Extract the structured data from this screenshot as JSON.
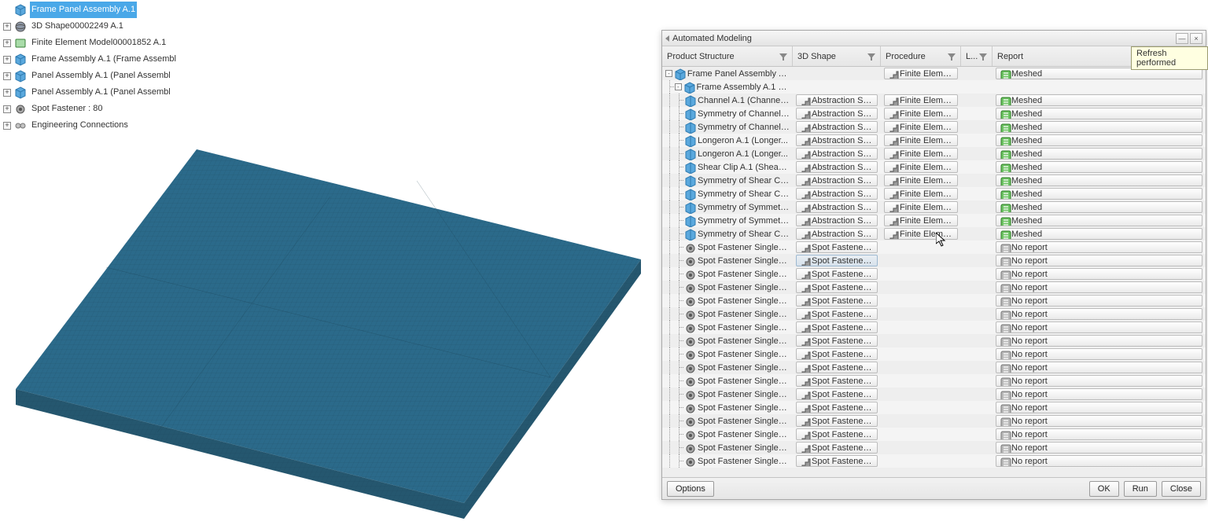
{
  "left_tree": [
    {
      "icon": "cube",
      "label": "Frame Panel Assembly A.1",
      "selected": true,
      "expand": ""
    },
    {
      "icon": "sphere",
      "label": "3D Shape00002249 A.1",
      "expand": "+"
    },
    {
      "icon": "part",
      "label": "Finite Element Model00001852 A.1",
      "expand": "+"
    },
    {
      "icon": "cube",
      "label": "Frame Assembly A.1 (Frame Assembl",
      "expand": "+"
    },
    {
      "icon": "cube",
      "label": "Panel Assembly A.1 (Panel Assembl",
      "expand": "+"
    },
    {
      "icon": "cube",
      "label": "Panel Assembly A.1 (Panel Assembl",
      "expand": "+"
    },
    {
      "icon": "fast",
      "label": "Spot Fastener : 80",
      "expand": "+"
    },
    {
      "icon": "conn",
      "label": "Engineering Connections",
      "expand": "+"
    }
  ],
  "dialog": {
    "title": "Automated Modeling",
    "columns": {
      "ps": "Product Structure",
      "sh": "3D Shape",
      "pr": "Procedure",
      "lv": "L...",
      "rp": "Report"
    },
    "footer": {
      "options": "Options",
      "ok": "OK",
      "run": "Run",
      "close": "Close"
    },
    "rows": [
      {
        "lvl": 0,
        "pm": "-",
        "icon": "cube",
        "ps": "Frame Panel Assembly A.1",
        "sh": "",
        "pr": "Finite Elemen...",
        "pri": "step",
        "rp": "Meshed",
        "rpi": "m"
      },
      {
        "lvl": 1,
        "pm": "-",
        "icon": "cube",
        "ps": "Frame Assembly A.1 (Fr...",
        "sh": "",
        "pr": "",
        "rp": ""
      },
      {
        "lvl": 2,
        "pm": "",
        "icon": "symm",
        "ps": "Channel A.1 (Channel.1)",
        "sh": "Abstraction Shap...",
        "shi": "step",
        "pr": "Finite Elemen...",
        "pri": "step",
        "rp": "Meshed",
        "rpi": "m"
      },
      {
        "lvl": 2,
        "pm": "",
        "icon": "symm",
        "ps": "Symmetry of Channel A...",
        "sh": "Abstraction Shap...",
        "shi": "step",
        "pr": "Finite Elemen...",
        "pri": "step",
        "rp": "Meshed",
        "rpi": "m"
      },
      {
        "lvl": 2,
        "pm": "",
        "icon": "symm",
        "ps": "Symmetry of Channel A...",
        "sh": "Abstraction Shap...",
        "shi": "step",
        "pr": "Finite Elemen...",
        "pri": "step",
        "rp": "Meshed",
        "rpi": "m"
      },
      {
        "lvl": 2,
        "pm": "",
        "icon": "symm",
        "ps": "Longeron A.1 (Longer...",
        "sh": "Abstraction Shap...",
        "shi": "step",
        "pr": "Finite Elemen...",
        "pri": "step",
        "rp": "Meshed",
        "rpi": "m"
      },
      {
        "lvl": 2,
        "pm": "",
        "icon": "symm",
        "ps": "Longeron A.1 (Longer...",
        "sh": "Abstraction Shap...",
        "shi": "step",
        "pr": "Finite Elemen...",
        "pri": "step",
        "rp": "Meshed",
        "rpi": "m"
      },
      {
        "lvl": 2,
        "pm": "",
        "icon": "symm",
        "ps": "Shear Clip A.1 (Shear Cl...",
        "sh": "Abstraction Shap...",
        "shi": "step",
        "pr": "Finite Elemen...",
        "pri": "step",
        "rp": "Meshed",
        "rpi": "m"
      },
      {
        "lvl": 2,
        "pm": "",
        "icon": "symm",
        "ps": "Symmetry of Shear Clip...",
        "sh": "Abstraction Shap...",
        "shi": "step",
        "pr": "Finite Elemen...",
        "pri": "step",
        "rp": "Meshed",
        "rpi": "m"
      },
      {
        "lvl": 2,
        "pm": "",
        "icon": "symm",
        "ps": "Symmetry of Shear Clip...",
        "sh": "Abstraction Shap...",
        "shi": "step",
        "pr": "Finite Elemen...",
        "pri": "step",
        "rp": "Meshed",
        "rpi": "m"
      },
      {
        "lvl": 2,
        "pm": "",
        "icon": "symm",
        "ps": "Symmetry of Symmetr...",
        "sh": "Abstraction Shap...",
        "shi": "step",
        "pr": "Finite Elemen...",
        "pri": "step",
        "rp": "Meshed",
        "rpi": "m"
      },
      {
        "lvl": 2,
        "pm": "",
        "icon": "symm",
        "ps": "Symmetry of Symmetr...",
        "sh": "Abstraction Shap...",
        "shi": "step",
        "pr": "Finite Elemen...",
        "pri": "step",
        "rp": "Meshed",
        "rpi": "m"
      },
      {
        "lvl": 2,
        "pm": "",
        "icon": "symm",
        "ps": "Symmetry of Shear Clip...",
        "sh": "Abstraction Shap...",
        "shi": "step",
        "pr": "Finite Elemen...",
        "pri": "step",
        "rp": "Meshed",
        "rpi": "m"
      },
      {
        "lvl": 2,
        "pm": "",
        "icon": "fast",
        "ps": "Spot Fastener Single00...",
        "sh": "Spot Fastener Rep...",
        "shi": "step",
        "pr": "",
        "rp": "No report",
        "rpi": "n"
      },
      {
        "lvl": 2,
        "pm": "",
        "icon": "fast",
        "ps": "Spot Fastener Single00...",
        "sh": "Spot Fastener Rep...",
        "shi": "step",
        "sel": true,
        "pr": "",
        "rp": "No report",
        "rpi": "n"
      },
      {
        "lvl": 2,
        "pm": "",
        "icon": "fast",
        "ps": "Spot Fastener Single00...",
        "sh": "Spot Fastener Rep...",
        "shi": "step",
        "pr": "",
        "rp": "No report",
        "rpi": "n"
      },
      {
        "lvl": 2,
        "pm": "",
        "icon": "fast",
        "ps": "Spot Fastener Single00...",
        "sh": "Spot Fastener Rep...",
        "shi": "step",
        "pr": "",
        "rp": "No report",
        "rpi": "n"
      },
      {
        "lvl": 2,
        "pm": "",
        "icon": "fast",
        "ps": "Spot Fastener Single00...",
        "sh": "Spot Fastener Rep...",
        "shi": "step",
        "pr": "",
        "rp": "No report",
        "rpi": "n"
      },
      {
        "lvl": 2,
        "pm": "",
        "icon": "fast",
        "ps": "Spot Fastener Single00...",
        "sh": "Spot Fastener Rep...",
        "shi": "step",
        "pr": "",
        "rp": "No report",
        "rpi": "n"
      },
      {
        "lvl": 2,
        "pm": "",
        "icon": "fast",
        "ps": "Spot Fastener Single00...",
        "sh": "Spot Fastener Rep...",
        "shi": "step",
        "pr": "",
        "rp": "No report",
        "rpi": "n"
      },
      {
        "lvl": 2,
        "pm": "",
        "icon": "fast",
        "ps": "Spot Fastener Single00...",
        "sh": "Spot Fastener Rep...",
        "shi": "step",
        "pr": "",
        "rp": "No report",
        "rpi": "n"
      },
      {
        "lvl": 2,
        "pm": "",
        "icon": "fast",
        "ps": "Spot Fastener Single00...",
        "sh": "Spot Fastener Rep...",
        "shi": "step",
        "pr": "",
        "rp": "No report",
        "rpi": "n"
      },
      {
        "lvl": 2,
        "pm": "",
        "icon": "fast",
        "ps": "Spot Fastener Single00...",
        "sh": "Spot Fastener Rep...",
        "shi": "step",
        "pr": "",
        "rp": "No report",
        "rpi": "n"
      },
      {
        "lvl": 2,
        "pm": "",
        "icon": "fast",
        "ps": "Spot Fastener Single00...",
        "sh": "Spot Fastener Rep...",
        "shi": "step",
        "pr": "",
        "rp": "No report",
        "rpi": "n"
      },
      {
        "lvl": 2,
        "pm": "",
        "icon": "fast",
        "ps": "Spot Fastener Single00...",
        "sh": "Spot Fastener Rep...",
        "shi": "step",
        "pr": "",
        "rp": "No report",
        "rpi": "n"
      },
      {
        "lvl": 2,
        "pm": "",
        "icon": "fast",
        "ps": "Spot Fastener Single00...",
        "sh": "Spot Fastener Rep...",
        "shi": "step",
        "pr": "",
        "rp": "No report",
        "rpi": "n"
      },
      {
        "lvl": 2,
        "pm": "",
        "icon": "fast",
        "ps": "Spot Fastener Single00...",
        "sh": "Spot Fastener Rep...",
        "shi": "step",
        "pr": "",
        "rp": "No report",
        "rpi": "n"
      },
      {
        "lvl": 2,
        "pm": "",
        "icon": "fast",
        "ps": "Spot Fastener Single00...",
        "sh": "Spot Fastener Rep...",
        "shi": "step",
        "pr": "",
        "rp": "No report",
        "rpi": "n"
      },
      {
        "lvl": 2,
        "pm": "",
        "icon": "fast",
        "ps": "Spot Fastener Single00...",
        "sh": "Spot Fastener Rep...",
        "shi": "step",
        "pr": "",
        "rp": "No report",
        "rpi": "n"
      },
      {
        "lvl": 2,
        "pm": "",
        "icon": "fast",
        "ps": "Spot Fastener Single00...",
        "sh": "Spot Fastener Rep...",
        "shi": "step",
        "pr": "",
        "rp": "No report",
        "rpi": "n"
      }
    ]
  },
  "tooltip": "Refresh performed"
}
